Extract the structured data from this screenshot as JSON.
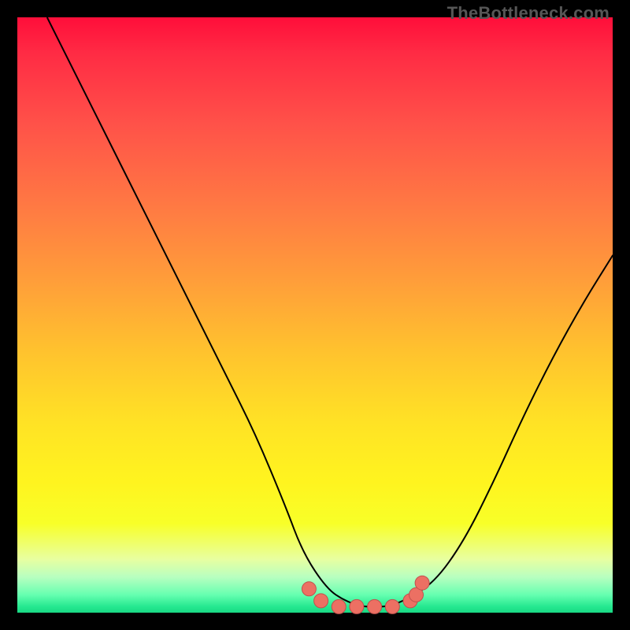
{
  "watermark": "TheBottleneck.com",
  "colors": {
    "frame": "#000000",
    "curve_stroke": "#000000",
    "marker_fill": "#ec7063",
    "marker_stroke": "#c0504d"
  },
  "chart_data": {
    "type": "line",
    "title": "",
    "xlabel": "",
    "ylabel": "",
    "xlim": [
      0,
      100
    ],
    "ylim": [
      0,
      100
    ],
    "grid": false,
    "legend": false,
    "series": [
      {
        "name": "bottleneck-curve",
        "x": [
          5,
          10,
          15,
          20,
          25,
          30,
          35,
          40,
          45,
          48,
          52,
          55,
          58,
          60,
          62,
          65,
          70,
          75,
          80,
          85,
          90,
          95,
          100
        ],
        "y": [
          100,
          90,
          80,
          70,
          60,
          50,
          40,
          30,
          18,
          10,
          4,
          2,
          1,
          1,
          1,
          2,
          5,
          12,
          22,
          33,
          43,
          52,
          60
        ]
      }
    ],
    "markers": {
      "name": "bottleneck-floor-markers",
      "x": [
        49,
        51,
        54,
        57,
        60,
        63,
        66,
        67,
        68
      ],
      "y": [
        4,
        2,
        1,
        1,
        1,
        1,
        2,
        3,
        5
      ]
    },
    "background_gradient": {
      "top": "#ff0e3a",
      "mid": "#fff41f",
      "bottom": "#19d883"
    }
  }
}
